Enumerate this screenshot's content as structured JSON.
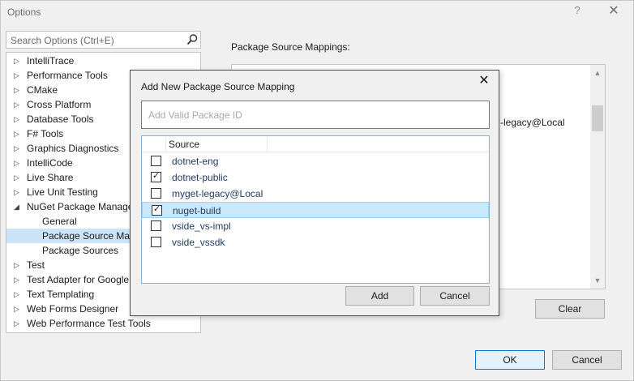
{
  "window": {
    "title": "Options",
    "help_glyph": "?",
    "close_glyph": "✕"
  },
  "search": {
    "placeholder": "Search Options (Ctrl+E)"
  },
  "tree": {
    "items": [
      {
        "label": "IntelliTrace",
        "arrow": "▷"
      },
      {
        "label": "Performance Tools",
        "arrow": "▷"
      },
      {
        "label": "CMake",
        "arrow": "▷"
      },
      {
        "label": "Cross Platform",
        "arrow": "▷"
      },
      {
        "label": "Database Tools",
        "arrow": "▷"
      },
      {
        "label": "F# Tools",
        "arrow": "▷"
      },
      {
        "label": "Graphics Diagnostics",
        "arrow": "▷"
      },
      {
        "label": "IntelliCode",
        "arrow": "▷"
      },
      {
        "label": "Live Share",
        "arrow": "▷"
      },
      {
        "label": "Live Unit Testing",
        "arrow": "▷"
      },
      {
        "label": "NuGet Package Manager",
        "arrow": "◢"
      },
      {
        "label": "General",
        "arrow": ""
      },
      {
        "label": "Package Source Mappings",
        "arrow": ""
      },
      {
        "label": "Package Sources",
        "arrow": ""
      },
      {
        "label": "Test",
        "arrow": "▷"
      },
      {
        "label": "Test Adapter for Google Test",
        "arrow": "▷"
      },
      {
        "label": "Text Templating",
        "arrow": "▷"
      },
      {
        "label": "Web Forms Designer",
        "arrow": "▷"
      },
      {
        "label": "Web Performance Test Tools",
        "arrow": "▷"
      }
    ]
  },
  "mappings": {
    "label": "Package Source Mappings:",
    "visible_entry": "-legacy@Local",
    "scroll_up": "▲",
    "scroll_down": "▼"
  },
  "buttons": {
    "clear": "Clear",
    "ok": "OK",
    "cancel": "Cancel"
  },
  "dialog": {
    "title": "Add New Package Source Mapping",
    "close_glyph": "✕",
    "package_id_placeholder": "Add Valid Package ID",
    "package_id_value": "",
    "column_header": "Source",
    "check_mark": "✓",
    "sources": [
      {
        "name": "dotnet-eng",
        "checked": false
      },
      {
        "name": "dotnet-public",
        "checked": true
      },
      {
        "name": "myget-legacy@Local",
        "checked": false
      },
      {
        "name": "nuget-build",
        "checked": true,
        "selected": true
      },
      {
        "name": "vside_vs-impl",
        "checked": false
      },
      {
        "name": "vside_vssdk",
        "checked": false
      }
    ],
    "add_label": "Add",
    "cancel_label": "Cancel"
  }
}
